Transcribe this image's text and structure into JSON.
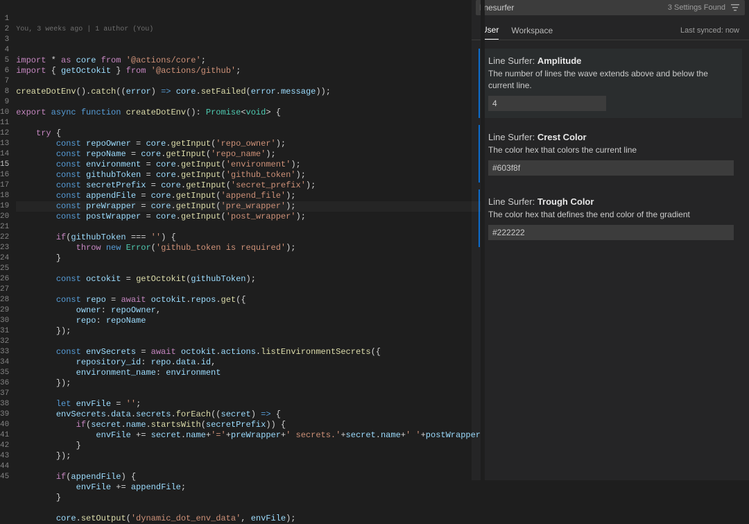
{
  "blame": "You, 3 weeks ago | 1 author (You)",
  "code_lines": [
    [
      [
        "kw",
        "import"
      ],
      [
        "punct",
        " * "
      ],
      [
        "kw",
        "as"
      ],
      [
        "punct",
        " "
      ],
      [
        "var",
        "core"
      ],
      [
        "punct",
        " "
      ],
      [
        "kw",
        "from"
      ],
      [
        "punct",
        " "
      ],
      [
        "str",
        "'@actions/core'"
      ],
      [
        "punct",
        ";"
      ]
    ],
    [
      [
        "kw",
        "import"
      ],
      [
        "punct",
        " { "
      ],
      [
        "var",
        "getOctokit"
      ],
      [
        "punct",
        " } "
      ],
      [
        "kw",
        "from"
      ],
      [
        "punct",
        " "
      ],
      [
        "str",
        "'@actions/github'"
      ],
      [
        "punct",
        ";"
      ]
    ],
    [],
    [
      [
        "fn",
        "createDotEnv"
      ],
      [
        "punct",
        "()."
      ],
      [
        "fn",
        "catch"
      ],
      [
        "punct",
        "(("
      ],
      [
        "var",
        "error"
      ],
      [
        "punct",
        ") "
      ],
      [
        "const",
        "=>"
      ],
      [
        "punct",
        " "
      ],
      [
        "var",
        "core"
      ],
      [
        "punct",
        "."
      ],
      [
        "fn",
        "setFailed"
      ],
      [
        "punct",
        "("
      ],
      [
        "var",
        "error"
      ],
      [
        "punct",
        "."
      ],
      [
        "var",
        "message"
      ],
      [
        "punct",
        "));"
      ]
    ],
    [],
    [
      [
        "kw",
        "export"
      ],
      [
        "punct",
        " "
      ],
      [
        "const",
        "async"
      ],
      [
        "punct",
        " "
      ],
      [
        "const",
        "function"
      ],
      [
        "punct",
        " "
      ],
      [
        "fn",
        "createDotEnv"
      ],
      [
        "punct",
        "(): "
      ],
      [
        "type",
        "Promise"
      ],
      [
        "punct",
        "<"
      ],
      [
        "type",
        "void"
      ],
      [
        "punct",
        "> {"
      ]
    ],
    [],
    [
      [
        "punct",
        "    "
      ],
      [
        "kw",
        "try"
      ],
      [
        "punct",
        " {"
      ]
    ],
    [
      [
        "punct",
        "        "
      ],
      [
        "const",
        "const"
      ],
      [
        "punct",
        " "
      ],
      [
        "var",
        "repoOwner"
      ],
      [
        "punct",
        " = "
      ],
      [
        "var",
        "core"
      ],
      [
        "punct",
        "."
      ],
      [
        "fn",
        "getInput"
      ],
      [
        "punct",
        "("
      ],
      [
        "str",
        "'repo_owner'"
      ],
      [
        "punct",
        ");"
      ]
    ],
    [
      [
        "punct",
        "        "
      ],
      [
        "const",
        "const"
      ],
      [
        "punct",
        " "
      ],
      [
        "var",
        "repoName"
      ],
      [
        "punct",
        " = "
      ],
      [
        "var",
        "core"
      ],
      [
        "punct",
        "."
      ],
      [
        "fn",
        "getInput"
      ],
      [
        "punct",
        "("
      ],
      [
        "str",
        "'repo_name'"
      ],
      [
        "punct",
        ");"
      ]
    ],
    [
      [
        "punct",
        "        "
      ],
      [
        "const",
        "const"
      ],
      [
        "punct",
        " "
      ],
      [
        "var",
        "environment"
      ],
      [
        "punct",
        " = "
      ],
      [
        "var",
        "core"
      ],
      [
        "punct",
        "."
      ],
      [
        "fn",
        "getInput"
      ],
      [
        "punct",
        "("
      ],
      [
        "str",
        "'environment'"
      ],
      [
        "punct",
        ");"
      ]
    ],
    [
      [
        "punct",
        "        "
      ],
      [
        "const",
        "const"
      ],
      [
        "punct",
        " "
      ],
      [
        "var",
        "githubToken"
      ],
      [
        "punct",
        " = "
      ],
      [
        "var",
        "core"
      ],
      [
        "punct",
        "."
      ],
      [
        "fn",
        "getInput"
      ],
      [
        "punct",
        "("
      ],
      [
        "str",
        "'github_token'"
      ],
      [
        "punct",
        ");"
      ]
    ],
    [
      [
        "punct",
        "        "
      ],
      [
        "const",
        "const"
      ],
      [
        "punct",
        " "
      ],
      [
        "var",
        "secretPrefix"
      ],
      [
        "punct",
        " = "
      ],
      [
        "var",
        "core"
      ],
      [
        "punct",
        "."
      ],
      [
        "fn",
        "getInput"
      ],
      [
        "punct",
        "("
      ],
      [
        "str",
        "'secret_prefix'"
      ],
      [
        "punct",
        ");"
      ]
    ],
    [
      [
        "punct",
        "        "
      ],
      [
        "const",
        "const"
      ],
      [
        "punct",
        " "
      ],
      [
        "var",
        "appendFile"
      ],
      [
        "punct",
        " = "
      ],
      [
        "var",
        "core"
      ],
      [
        "punct",
        "."
      ],
      [
        "fn",
        "getInput"
      ],
      [
        "punct",
        "("
      ],
      [
        "str",
        "'append_file'"
      ],
      [
        "punct",
        ");"
      ]
    ],
    [
      [
        "punct",
        "        "
      ],
      [
        "const",
        "const"
      ],
      [
        "punct",
        " "
      ],
      [
        "var",
        "preWrapper"
      ],
      [
        "punct",
        " = "
      ],
      [
        "var",
        "core"
      ],
      [
        "punct",
        "."
      ],
      [
        "fn",
        "getInput"
      ],
      [
        "punct",
        "("
      ],
      [
        "str",
        "'pre_wrapper'"
      ],
      [
        "punct",
        ");"
      ]
    ],
    [
      [
        "punct",
        "        "
      ],
      [
        "const",
        "const"
      ],
      [
        "punct",
        " "
      ],
      [
        "var",
        "postWrapper"
      ],
      [
        "punct",
        " = "
      ],
      [
        "var",
        "core"
      ],
      [
        "punct",
        "."
      ],
      [
        "fn",
        "getInput"
      ],
      [
        "punct",
        "("
      ],
      [
        "str",
        "'post_wrapper'"
      ],
      [
        "punct",
        ");"
      ]
    ],
    [],
    [
      [
        "punct",
        "        "
      ],
      [
        "kw",
        "if"
      ],
      [
        "punct",
        "("
      ],
      [
        "var",
        "githubToken"
      ],
      [
        "punct",
        " === "
      ],
      [
        "str",
        "''"
      ],
      [
        "punct",
        ") {"
      ]
    ],
    [
      [
        "punct",
        "            "
      ],
      [
        "kw",
        "throw"
      ],
      [
        "punct",
        " "
      ],
      [
        "const",
        "new"
      ],
      [
        "punct",
        " "
      ],
      [
        "type",
        "Error"
      ],
      [
        "punct",
        "("
      ],
      [
        "str",
        "'github_token is required'"
      ],
      [
        "punct",
        ");"
      ]
    ],
    [
      [
        "punct",
        "        }"
      ]
    ],
    [],
    [
      [
        "punct",
        "        "
      ],
      [
        "const",
        "const"
      ],
      [
        "punct",
        " "
      ],
      [
        "var",
        "octokit"
      ],
      [
        "punct",
        " = "
      ],
      [
        "fn",
        "getOctokit"
      ],
      [
        "punct",
        "("
      ],
      [
        "var",
        "githubToken"
      ],
      [
        "punct",
        ");"
      ]
    ],
    [],
    [
      [
        "punct",
        "        "
      ],
      [
        "const",
        "const"
      ],
      [
        "punct",
        " "
      ],
      [
        "var",
        "repo"
      ],
      [
        "punct",
        " = "
      ],
      [
        "kw",
        "await"
      ],
      [
        "punct",
        " "
      ],
      [
        "var",
        "octokit"
      ],
      [
        "punct",
        "."
      ],
      [
        "var",
        "repos"
      ],
      [
        "punct",
        "."
      ],
      [
        "fn",
        "get"
      ],
      [
        "punct",
        "({"
      ]
    ],
    [
      [
        "punct",
        "            "
      ],
      [
        "var",
        "owner"
      ],
      [
        "punct",
        ": "
      ],
      [
        "var",
        "repoOwner"
      ],
      [
        "punct",
        ","
      ]
    ],
    [
      [
        "punct",
        "            "
      ],
      [
        "var",
        "repo"
      ],
      [
        "punct",
        ": "
      ],
      [
        "var",
        "repoName"
      ]
    ],
    [
      [
        "punct",
        "        });"
      ]
    ],
    [],
    [
      [
        "punct",
        "        "
      ],
      [
        "const",
        "const"
      ],
      [
        "punct",
        " "
      ],
      [
        "var",
        "envSecrets"
      ],
      [
        "punct",
        " = "
      ],
      [
        "kw",
        "await"
      ],
      [
        "punct",
        " "
      ],
      [
        "var",
        "octokit"
      ],
      [
        "punct",
        "."
      ],
      [
        "var",
        "actions"
      ],
      [
        "punct",
        "."
      ],
      [
        "fn",
        "listEnvironmentSecrets"
      ],
      [
        "punct",
        "({"
      ]
    ],
    [
      [
        "punct",
        "            "
      ],
      [
        "var",
        "repository_id"
      ],
      [
        "punct",
        ": "
      ],
      [
        "var",
        "repo"
      ],
      [
        "punct",
        "."
      ],
      [
        "var",
        "data"
      ],
      [
        "punct",
        "."
      ],
      [
        "var",
        "id"
      ],
      [
        "punct",
        ","
      ]
    ],
    [
      [
        "punct",
        "            "
      ],
      [
        "var",
        "environment_name"
      ],
      [
        "punct",
        ": "
      ],
      [
        "var",
        "environment"
      ]
    ],
    [
      [
        "punct",
        "        });"
      ]
    ],
    [],
    [
      [
        "punct",
        "        "
      ],
      [
        "const",
        "let"
      ],
      [
        "punct",
        " "
      ],
      [
        "var",
        "envFile"
      ],
      [
        "punct",
        " = "
      ],
      [
        "str",
        "''"
      ],
      [
        "punct",
        ";"
      ]
    ],
    [
      [
        "punct",
        "        "
      ],
      [
        "var",
        "envSecrets"
      ],
      [
        "punct",
        "."
      ],
      [
        "var",
        "data"
      ],
      [
        "punct",
        "."
      ],
      [
        "var",
        "secrets"
      ],
      [
        "punct",
        "."
      ],
      [
        "fn",
        "forEach"
      ],
      [
        "punct",
        "(("
      ],
      [
        "var",
        "secret"
      ],
      [
        "punct",
        ") "
      ],
      [
        "const",
        "=>"
      ],
      [
        "punct",
        " {"
      ]
    ],
    [
      [
        "punct",
        "            "
      ],
      [
        "kw",
        "if"
      ],
      [
        "punct",
        "("
      ],
      [
        "var",
        "secret"
      ],
      [
        "punct",
        "."
      ],
      [
        "var",
        "name"
      ],
      [
        "punct",
        "."
      ],
      [
        "fn",
        "startsWith"
      ],
      [
        "punct",
        "("
      ],
      [
        "var",
        "secretPrefix"
      ],
      [
        "punct",
        ")) {"
      ]
    ],
    [
      [
        "punct",
        "                "
      ],
      [
        "var",
        "envFile"
      ],
      [
        "punct",
        " += "
      ],
      [
        "var",
        "secret"
      ],
      [
        "punct",
        "."
      ],
      [
        "var",
        "name"
      ],
      [
        "punct",
        "+"
      ],
      [
        "str",
        "'='"
      ],
      [
        "punct",
        "+"
      ],
      [
        "var",
        "preWrapper"
      ],
      [
        "punct",
        "+"
      ],
      [
        "str",
        "' secrets.'"
      ],
      [
        "punct",
        "+"
      ],
      [
        "var",
        "secret"
      ],
      [
        "punct",
        "."
      ],
      [
        "var",
        "name"
      ],
      [
        "punct",
        "+"
      ],
      [
        "str",
        "' '"
      ],
      [
        "punct",
        "+"
      ],
      [
        "var",
        "postWrapper"
      ]
    ],
    [
      [
        "punct",
        "            }"
      ]
    ],
    [
      [
        "punct",
        "        });"
      ]
    ],
    [],
    [
      [
        "punct",
        "        "
      ],
      [
        "kw",
        "if"
      ],
      [
        "punct",
        "("
      ],
      [
        "var",
        "appendFile"
      ],
      [
        "punct",
        ") {"
      ]
    ],
    [
      [
        "punct",
        "            "
      ],
      [
        "var",
        "envFile"
      ],
      [
        "punct",
        " += "
      ],
      [
        "var",
        "appendFile"
      ],
      [
        "punct",
        ";"
      ]
    ],
    [
      [
        "punct",
        "        }"
      ]
    ],
    [],
    [
      [
        "punct",
        "        "
      ],
      [
        "var",
        "core"
      ],
      [
        "punct",
        "."
      ],
      [
        "fn",
        "setOutput"
      ],
      [
        "punct",
        "("
      ],
      [
        "str",
        "'dynamic_dot_env_data'"
      ],
      [
        "punct",
        ", "
      ],
      [
        "var",
        "envFile"
      ],
      [
        "punct",
        ");"
      ]
    ]
  ],
  "active_line": 15,
  "settings": {
    "search_value": "linesurfer",
    "found_text": "3 Settings Found",
    "tabs": {
      "user": "User",
      "workspace": "Workspace"
    },
    "sync": "Last synced: now",
    "items": [
      {
        "prefix": "Line Surfer: ",
        "name": "Amplitude",
        "desc": "The number of lines the wave extends above and below the current line.",
        "value": "4",
        "wide": false,
        "hovered": true
      },
      {
        "prefix": "Line Surfer: ",
        "name": "Crest Color",
        "desc": "The color hex that colors the current line",
        "value": "#603f8f",
        "wide": true,
        "hovered": false
      },
      {
        "prefix": "Line Surfer: ",
        "name": "Trough Color",
        "desc": "The color hex that defines the end color of the gradient",
        "value": "#222222",
        "wide": true,
        "hovered": false
      }
    ]
  }
}
